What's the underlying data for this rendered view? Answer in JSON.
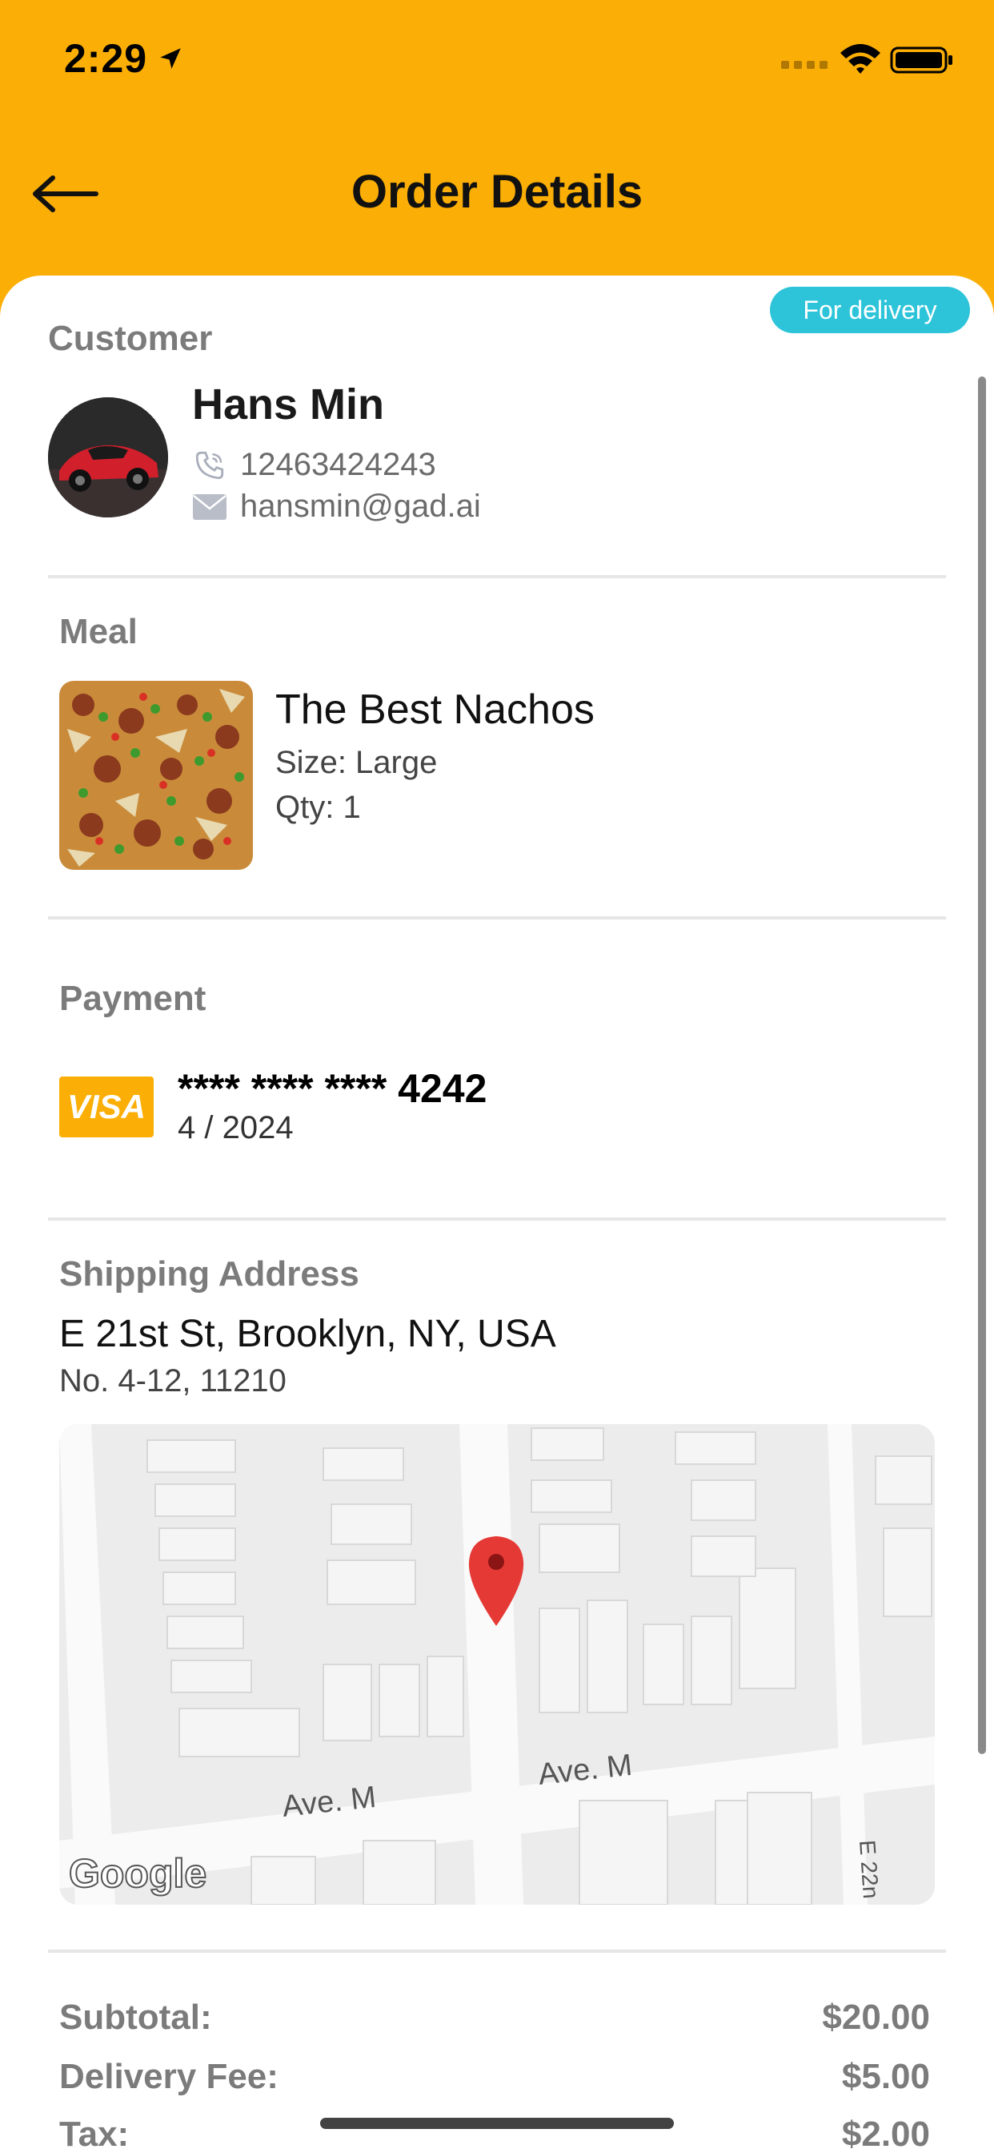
{
  "status_bar": {
    "time": "2:29"
  },
  "header": {
    "title": "Order Details"
  },
  "badge": "For delivery",
  "customer": {
    "heading": "Customer",
    "name": "Hans Min",
    "phone": "12463424243",
    "email": "hansmin@gad.ai"
  },
  "meal": {
    "heading": "Meal",
    "name": "The Best Nachos",
    "size": "Size: Large",
    "qty": "Qty: 1"
  },
  "payment": {
    "heading": "Payment",
    "brand": "VISA",
    "card_number": "**** **** **** 4242",
    "expiry": "4 / 2024"
  },
  "shipping": {
    "heading": "Shipping Address",
    "line1": "E 21st St, Brooklyn, NY, USA",
    "line2": "No. 4-12, 11210",
    "map_street_1": "Ave. M",
    "map_street_2": "Ave. M",
    "map_street_3": "E 22n",
    "map_logo": "Google"
  },
  "summary": {
    "subtotal_label": "Subtotal:",
    "subtotal": "$20.00",
    "delivery_label": "Delivery Fee:",
    "delivery": "$5.00",
    "tax_label": "Tax:",
    "tax": "$2.00"
  },
  "colors": {
    "accent": "#FBAE05",
    "badge": "#2DC4DA",
    "pin": "#E53935"
  }
}
